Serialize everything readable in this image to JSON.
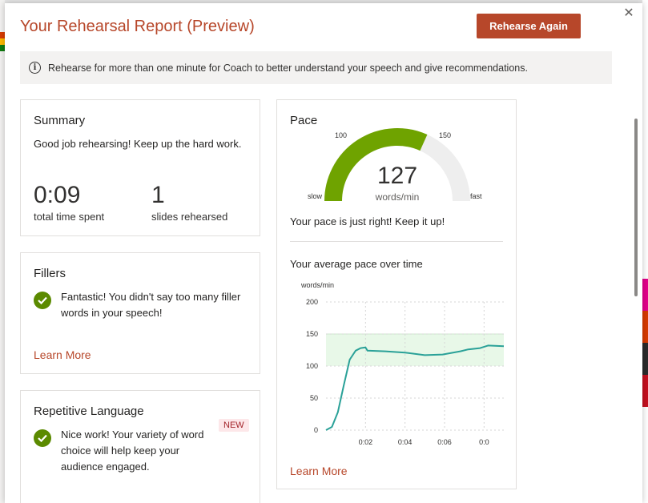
{
  "dialog": {
    "title": "Your Rehearsal Report (Preview)",
    "rehearse_again_label": "Rehearse Again",
    "close_symbol": "✕",
    "info_message": "Rehearse for more than one minute for Coach to better understand your speech and give recommendations."
  },
  "summary": {
    "heading": "Summary",
    "message": "Good job rehearsing! Keep up the hard work.",
    "time_value": "0:09",
    "time_label": "total time spent",
    "slides_value": "1",
    "slides_label": "slides rehearsed"
  },
  "fillers": {
    "heading": "Fillers",
    "message": "Fantastic! You didn't say too many filler words in your speech!",
    "learn_more": "Learn More"
  },
  "repetitive": {
    "heading": "Repetitive Language",
    "badge": "NEW",
    "message": "Nice work! Your variety of word choice will help keep your audience engaged."
  },
  "pace": {
    "heading": "Pace",
    "gauge_value": "127",
    "gauge_unit": "words/min",
    "gauge_label_low": "100",
    "gauge_label_high": "150",
    "gauge_slow": "slow",
    "gauge_fast": "fast",
    "gauge_min": 0,
    "gauge_max": 200,
    "message": "Your pace is just right! Keep it up!",
    "chart_title": "Your average pace over time",
    "learn_more": "Learn More"
  },
  "colors": {
    "accent": "#b7472a",
    "gauge_green": "#6fa300",
    "gauge_track": "#eeeeee",
    "check_green": "#5b8a00",
    "line_teal": "#2aa198",
    "target_band": "#e8f8e8"
  },
  "chart_data": {
    "type": "line",
    "title": "Your average pace over time",
    "ylabel": "words/min",
    "xlabel": "",
    "ylim": [
      0,
      200
    ],
    "yticks": [
      0,
      50,
      100,
      150,
      200
    ],
    "xlim": [
      0,
      9
    ],
    "xticks": [
      {
        "value": 2,
        "label": "0:02"
      },
      {
        "value": 4,
        "label": "0:04"
      },
      {
        "value": 6,
        "label": "0:06"
      },
      {
        "value": 8,
        "label": "0:0"
      }
    ],
    "band": [
      100,
      150
    ],
    "grid": true,
    "series": [
      {
        "x": [
          0,
          0.3,
          0.6,
          0.9,
          1.2,
          1.5,
          1.75,
          2.0,
          2.1,
          3.0,
          4.0,
          5.0,
          5.9,
          6.8,
          7.2,
          7.8,
          8.2,
          9.0
        ],
        "y": [
          0,
          5,
          28,
          70,
          110,
          124,
          128,
          129,
          124,
          123,
          121,
          117,
          118,
          123,
          126,
          128,
          132,
          131
        ]
      }
    ]
  }
}
